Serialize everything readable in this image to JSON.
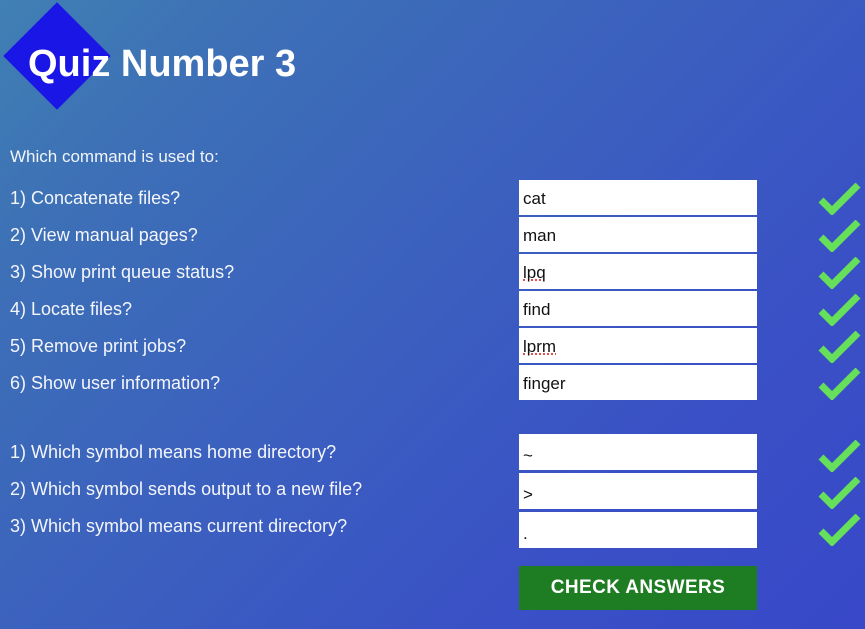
{
  "header": {
    "title": "Quiz Number 3",
    "diamond_color": "#1a16e6"
  },
  "theme": {
    "background_start": "#4080b4",
    "background_end": "#3848c8",
    "check_color": "#66e05a",
    "button_color": "#1e7d22",
    "field_background": "#ffffff",
    "text_color": "#f4f6fb"
  },
  "intro": "Which command is used to:",
  "groups": [
    {
      "questions": [
        "1) Concatenate files?",
        "2) View manual pages?",
        "3) Show print queue status?",
        "4) Locate files?",
        "5) Remove print jobs?",
        "6) Show user information?"
      ],
      "answers": [
        "cat",
        "man",
        "lpq",
        "find",
        "lprm",
        "finger"
      ],
      "misspelled": [
        false,
        false,
        true,
        false,
        true,
        false
      ],
      "checks": [
        "check-icon",
        "check-icon",
        "check-icon",
        "check-icon",
        "check-icon",
        "check-icon"
      ]
    },
    {
      "questions": [
        "1) Which symbol means home directory?",
        "2) Which symbol sends output to a new file?",
        "3) Which symbol means current directory?"
      ],
      "answers": [
        "~",
        ">",
        "."
      ],
      "misspelled": [
        false,
        false,
        false
      ],
      "checks": [
        "check-icon",
        "check-icon",
        "check-icon"
      ]
    }
  ],
  "submit": {
    "label": "CHECK ANSWERS"
  }
}
